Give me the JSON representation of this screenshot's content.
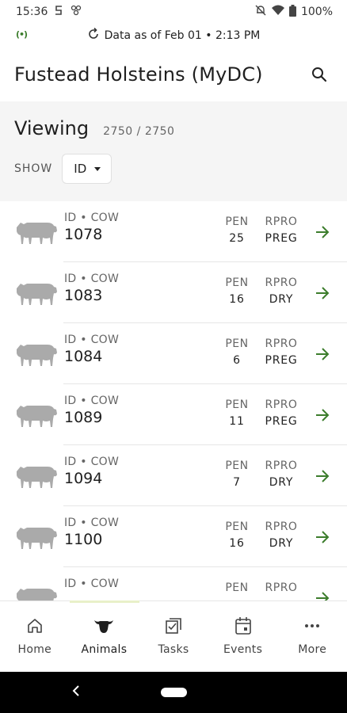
{
  "status_bar": {
    "time": "15:36",
    "battery": "100%",
    "icons": [
      "notification-s-icon",
      "app-icon",
      "mute-icon",
      "wifi-icon",
      "battery-icon"
    ]
  },
  "sync": {
    "live_indicator": "(•)",
    "text": "Data as of Feb 01 • 2:13 PM"
  },
  "app_bar": {
    "title": "Fustead Holsteins (MyDC)"
  },
  "viewing": {
    "title": "Viewing",
    "count": "2750 / 2750",
    "show_label": "SHOW",
    "show_value": "ID"
  },
  "list": {
    "pen_header": "PEN",
    "rpro_header": "RPRO",
    "animals": [
      {
        "label": "ID • COW",
        "id": "1078",
        "pen": "25",
        "rpro": "PREG"
      },
      {
        "label": "ID • COW",
        "id": "1083",
        "pen": "16",
        "rpro": "DRY"
      },
      {
        "label": "ID • COW",
        "id": "1084",
        "pen": "6",
        "rpro": "PREG"
      },
      {
        "label": "ID • COW",
        "id": "1089",
        "pen": "11",
        "rpro": "PREG"
      },
      {
        "label": "ID • COW",
        "id": "1094",
        "pen": "7",
        "rpro": "DRY"
      },
      {
        "label": "ID • COW",
        "id": "1100",
        "pen": "16",
        "rpro": "DRY"
      },
      {
        "label": "ID • COW",
        "id": "",
        "pen": "",
        "rpro": ""
      }
    ]
  },
  "nav": {
    "items": [
      {
        "label": "Home",
        "icon": "home-icon"
      },
      {
        "label": "Animals",
        "icon": "cow-head-icon"
      },
      {
        "label": "Tasks",
        "icon": "tasks-icon"
      },
      {
        "label": "Events",
        "icon": "calendar-icon"
      },
      {
        "label": "More",
        "icon": "more-icon"
      }
    ],
    "active": "Animals"
  },
  "colors": {
    "accent_green": "#3c7d2c",
    "cow_gray": "#aaaaaa",
    "panel_bg": "#f5f5f5",
    "active_indicator": "#e9f0c9"
  }
}
